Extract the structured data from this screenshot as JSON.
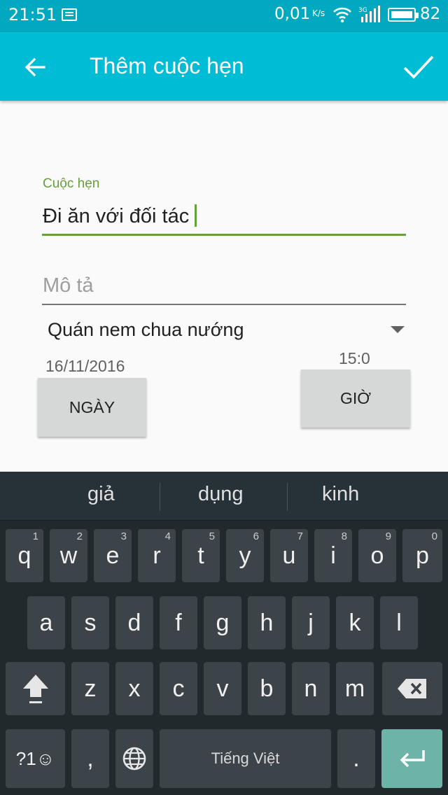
{
  "status_bar": {
    "time": "21:51",
    "network_speed": "0,01",
    "network_unit": "K/s",
    "network_type": "3G",
    "battery": "82"
  },
  "app_bar": {
    "title": "Thêm cuộc hẹn",
    "back_icon": "arrow-back-icon",
    "confirm_icon": "check-icon"
  },
  "form": {
    "title_label": "Cuộc hẹn",
    "title_value": "Đi ăn với đối tác",
    "description_placeholder": "Mô tả",
    "location_selected": "Quán nem chua nướng",
    "date_value": "16/11/2016",
    "time_value": "15:0",
    "date_button": "NGÀY",
    "time_button": "GIỜ"
  },
  "keyboard": {
    "suggestions": [
      "giả",
      "dụng",
      "kinh"
    ],
    "row1": [
      {
        "key": "q",
        "hint": "1"
      },
      {
        "key": "w",
        "hint": "2"
      },
      {
        "key": "e",
        "hint": "3"
      },
      {
        "key": "r",
        "hint": "4"
      },
      {
        "key": "t",
        "hint": "5"
      },
      {
        "key": "y",
        "hint": "6"
      },
      {
        "key": "u",
        "hint": "7"
      },
      {
        "key": "i",
        "hint": "8"
      },
      {
        "key": "o",
        "hint": "9"
      },
      {
        "key": "p",
        "hint": "0"
      }
    ],
    "row2": [
      "a",
      "s",
      "d",
      "f",
      "g",
      "h",
      "j",
      "k",
      "l"
    ],
    "row3": [
      "z",
      "x",
      "c",
      "v",
      "b",
      "n",
      "m"
    ],
    "symbols_key": "?1☺",
    "comma_key": ",",
    "space_label": "Tiếng Việt",
    "period_key": ".",
    "colors": {
      "background": "#21292d",
      "key": "#3c4449",
      "enter": "#6db3a8"
    }
  },
  "colors": {
    "app_bar": "#00bcd4",
    "status_bar": "#00a9bf",
    "accent_green": "#66a03a"
  }
}
